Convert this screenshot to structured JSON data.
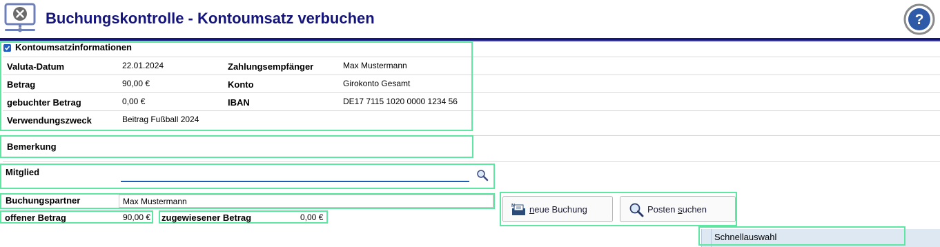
{
  "header": {
    "title": "Buchungskontrolle - Kontoumsatz verbuchen",
    "app_icon": "monitor-close-icon",
    "help_icon": "question-mark-icon",
    "accent": "#14147d"
  },
  "info": {
    "section_title": "Kontoumsatzinformationen",
    "section_checked": true,
    "valuta_label": "Valuta-Datum",
    "valuta_value": "22.01.2024",
    "recipient_label": "Zahlungsempfänger",
    "recipient_value": "Max Mustermann",
    "amount_label": "Betrag",
    "amount_value": "90,00 €",
    "account_label": "Konto",
    "account_value": "Girokonto Gesamt",
    "booked_label": "gebuchter Betrag",
    "booked_value": "0,00 €",
    "iban_label": "IBAN",
    "iban_value": "DE17 7115 1020 0000 1234 56",
    "purpose_label": "Verwendungszweck",
    "purpose_value": "Beitrag Fußball 2024"
  },
  "remark": {
    "label": "Bemerkung"
  },
  "member": {
    "label": "Mitglied",
    "value": "",
    "search_icon": "magnifier-icon"
  },
  "partner": {
    "label": "Buchungspartner",
    "value": "Max Mustermann"
  },
  "open_amount": {
    "label": "offener Betrag",
    "value": "90,00 €"
  },
  "assigned_amount": {
    "label": "zugewiesener Betrag",
    "value": "0,00 €"
  },
  "buttons": {
    "new_booking_prefix": "n",
    "new_booking_rest": "eue Buchung",
    "new_booking_icon": "new-document-icon",
    "search_items_prefix": "Posten ",
    "search_items_mnemonic": "s",
    "search_items_rest": "uchen",
    "search_items_icon": "magnifier-icon"
  },
  "quick_select": {
    "label": "Schnellauswahl"
  }
}
